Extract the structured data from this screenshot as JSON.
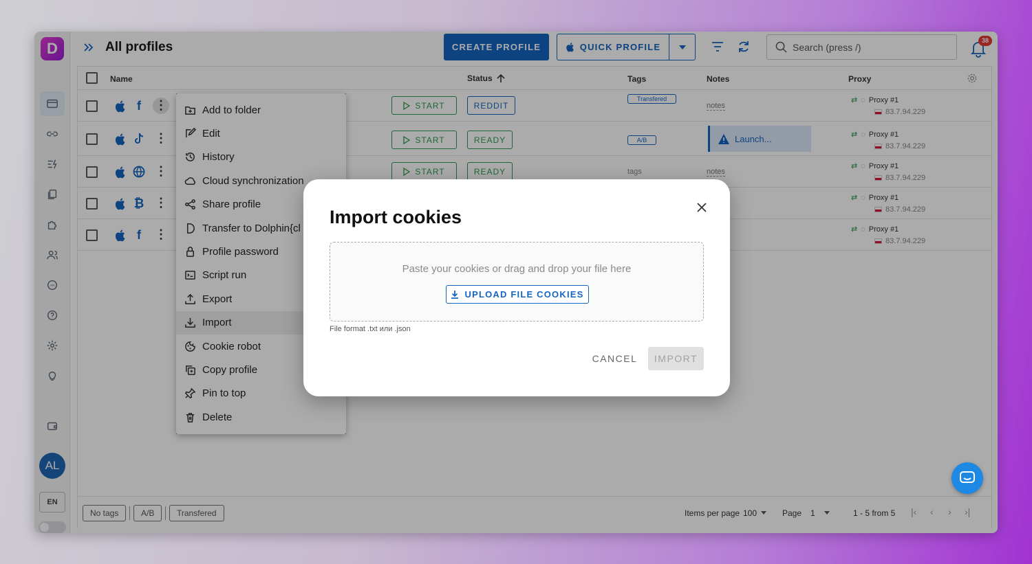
{
  "header": {
    "title": "All profiles",
    "create_label": "CREATE PROFILE",
    "quick_label": "QUICK PROFILE",
    "search_placeholder": "Search (press /)",
    "notifications_count": "38"
  },
  "sidebar": {
    "avatar": "AL",
    "lang": "EN"
  },
  "table": {
    "headers": {
      "name": "Name",
      "status": "Status",
      "tags": "Tags",
      "notes": "Notes",
      "proxy": "Proxy"
    },
    "rows": [
      {
        "os": "apple-icon",
        "site": "facebook-icon",
        "start": "START",
        "status": "REDDIT",
        "tag": "Transfered",
        "notes": "notes",
        "proxy": "Proxy #1",
        "ip": "83.7.94.229"
      },
      {
        "os": "apple-icon",
        "site": "tiktok-icon",
        "start": "START",
        "status": "READY",
        "tag": "A/B",
        "notes": "Launch...",
        "proxy": "Proxy #1",
        "ip": "83.7.94.229"
      },
      {
        "os": "apple-icon",
        "site": "globe-icon",
        "start": "START",
        "status": "READY",
        "tag": "tags",
        "notes": "notes",
        "proxy": "Proxy #1",
        "ip": "83.7.94.229"
      },
      {
        "os": "apple-icon",
        "site": "bitcoin-icon",
        "proxy": "Proxy #1",
        "ip": "83.7.94.229"
      },
      {
        "os": "apple-icon",
        "site": "facebook-icon",
        "proxy": "Proxy #1",
        "ip": "83.7.94.229"
      }
    ]
  },
  "context_menu": {
    "items": [
      {
        "label": "Add to folder",
        "icon": "folder-plus-icon"
      },
      {
        "label": "Edit",
        "icon": "edit-icon"
      },
      {
        "label": "History",
        "icon": "history-icon"
      },
      {
        "label": "Cloud synchronization",
        "icon": "cloud-icon"
      },
      {
        "label": "Share profile",
        "icon": "share-icon"
      },
      {
        "label": "Transfer to Dolphin{cl",
        "icon": "dolphin-icon"
      },
      {
        "label": "Profile password",
        "icon": "lock-icon"
      },
      {
        "label": "Script run",
        "icon": "terminal-icon"
      },
      {
        "label": "Export",
        "icon": "upload-icon"
      },
      {
        "label": "Import",
        "icon": "download-icon"
      },
      {
        "label": "Cookie robot",
        "icon": "cookie-icon"
      },
      {
        "label": "Copy profile",
        "icon": "copy-icon"
      },
      {
        "label": "Pin to top",
        "icon": "pin-icon"
      },
      {
        "label": "Delete",
        "icon": "trash-icon"
      }
    ]
  },
  "dialog": {
    "title": "Import cookies",
    "hint": "Paste your cookies or drag and drop your file here",
    "upload_label": "UPLOAD FILE COOKIES",
    "file_format": "File format .txt или .json",
    "cancel_label": "CANCEL",
    "import_label": "IMPORT"
  },
  "footer": {
    "tags": [
      "No tags",
      "A/B",
      "Transfered"
    ],
    "items_per_page_label": "Items per page",
    "items_per_page": "100",
    "page_label": "Page",
    "page": "1",
    "range": "1 - 5 from 5"
  },
  "colors": {
    "primary": "#1565c0",
    "success": "#2e9a4f",
    "badge": "#e53935"
  }
}
